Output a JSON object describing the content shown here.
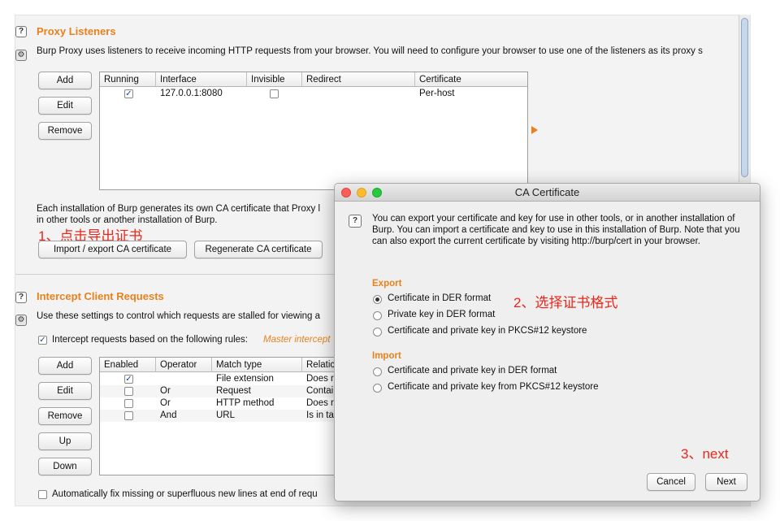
{
  "proxy_listeners": {
    "title": "Proxy Listeners",
    "description": "Burp Proxy uses listeners to receive incoming HTTP requests from your browser. You will need to configure your browser to use one of the listeners as its proxy s",
    "buttons": {
      "add": "Add",
      "edit": "Edit",
      "remove": "Remove"
    },
    "table": {
      "columns": [
        "Running",
        "Interface",
        "Invisible",
        "Redirect",
        "Certificate"
      ],
      "rows": [
        {
          "running": true,
          "interface": "127.0.0.1:8080",
          "invisible": false,
          "redirect": "",
          "certificate": "Per-host"
        }
      ]
    },
    "ca_text_line1": "Each installation of Burp generates its own CA certificate that Proxy l",
    "ca_text_line2": "in other tools or another installation of Burp.",
    "import_export_label": "Import / export CA certificate",
    "regenerate_label": "Regenerate CA certificate"
  },
  "intercept": {
    "title": "Intercept Client Requests",
    "description": "Use these settings to control which requests are stalled for viewing a",
    "checkbox_label": "Intercept requests based on the following rules:",
    "master_label": "Master intercept",
    "buttons": {
      "add": "Add",
      "edit": "Edit",
      "remove": "Remove",
      "up": "Up",
      "down": "Down"
    },
    "table": {
      "columns": [
        "Enabled",
        "Operator",
        "Match type",
        "Relatic"
      ],
      "rows": [
        {
          "enabled": true,
          "operator": "",
          "match_type": "File extension",
          "relationship": "Does r"
        },
        {
          "enabled": false,
          "operator": "Or",
          "match_type": "Request",
          "relationship": "Contai"
        },
        {
          "enabled": false,
          "operator": "Or",
          "match_type": "HTTP method",
          "relationship": "Does r"
        },
        {
          "enabled": false,
          "operator": "And",
          "match_type": "URL",
          "relationship": "Is in ta"
        }
      ]
    },
    "auto_fix_label": "Automatically fix missing or superfluous new lines at end of requ"
  },
  "dialog": {
    "title": "CA Certificate",
    "description": "You can export your certificate and key for use in other tools, or in another installation of Burp. You can import a certificate and key to use in this installation of Burp. Note that you can also export the current certificate by visiting http://burp/cert in your browser.",
    "export_label": "Export",
    "export_options": [
      {
        "label": "Certificate in DER format",
        "selected": true
      },
      {
        "label": "Private key in DER format",
        "selected": false
      },
      {
        "label": "Certificate and private key in PKCS#12 keystore",
        "selected": false
      }
    ],
    "import_label": "Import",
    "import_options": [
      {
        "label": "Certificate and private key in DER format",
        "selected": false
      },
      {
        "label": "Certificate and private key from PKCS#12 keystore",
        "selected": false
      }
    ],
    "cancel_label": "Cancel",
    "next_label": "Next"
  },
  "annotations": {
    "step1": "1、点击导出证书",
    "step2": "2、选择证书格式",
    "step3": "3、next",
    "color": "#e8281c"
  },
  "colors": {
    "section_title": "#e8811c",
    "checkbox_check": "#1c3f99",
    "traffic_red": "#fc5f57",
    "traffic_yellow": "#fdbc2e",
    "traffic_green": "#28c840"
  },
  "icons": {
    "help": "help-icon",
    "settings": "gear-icon",
    "expand": "expand-arrow-icon"
  }
}
